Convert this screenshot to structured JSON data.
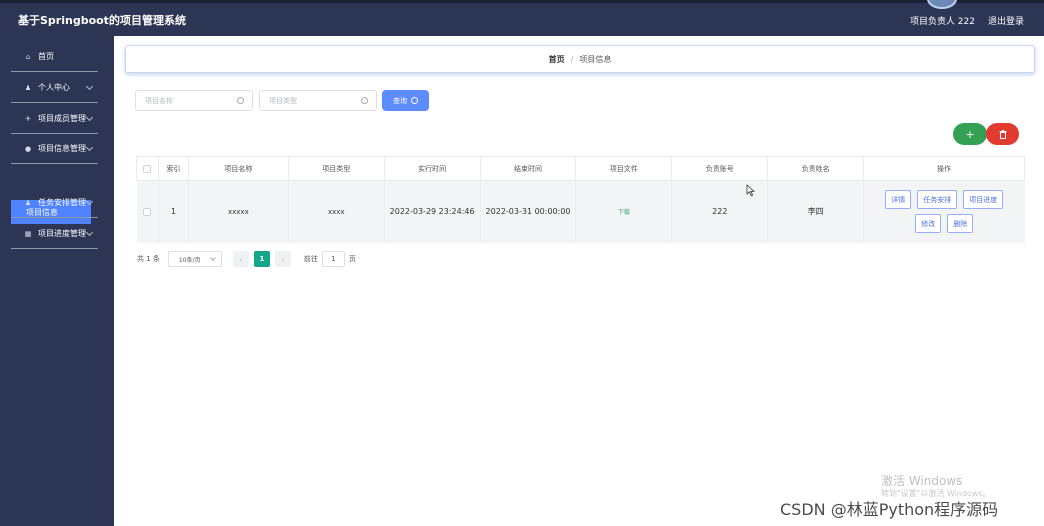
{
  "header": {
    "app_title": "基于Springboot的项目管理系统",
    "user_label": "项目负责人 222",
    "logout_label": "退出登录"
  },
  "sidebar": {
    "items": [
      {
        "label": "首页",
        "icon": "home-icon"
      },
      {
        "label": "个人中心",
        "icon": "user-icon"
      },
      {
        "label": "项目成员管理",
        "icon": "pin-icon"
      },
      {
        "label": "项目信息管理",
        "icon": "location-icon"
      },
      {
        "label": "任务安排管理",
        "icon": "user-icon"
      },
      {
        "label": "项目进度管理",
        "icon": "grid-icon"
      }
    ],
    "active_sub": "项目信息"
  },
  "breadcrumb": {
    "home": "首页",
    "separator": "/",
    "current": "项目信息"
  },
  "search": {
    "name_placeholder": "项目名称",
    "type_placeholder": "项目类型",
    "query_label": "查询"
  },
  "actions": {
    "add_label": "+",
    "delete_icon": "trash-icon"
  },
  "table": {
    "columns": [
      "索引",
      "项目名称",
      "项目类型",
      "实行时间",
      "结束时间",
      "项目文件",
      "负责账号",
      "负责姓名",
      "操作"
    ],
    "rows": [
      {
        "index": "1",
        "name": "xxxxx",
        "type": "xxxx",
        "start": "2022-03-29 23:24:46",
        "end": "2022-03-31 00:00:00",
        "file": "下载",
        "account": "222",
        "owner": "李四",
        "ops": [
          "详情",
          "任务安排",
          "项目进度",
          "修改",
          "删除"
        ]
      }
    ]
  },
  "pagination": {
    "total": "共 1 条",
    "page_size": "10条/页",
    "current_page": "1",
    "goto_label": "前往",
    "goto_value": "1",
    "page_unit": "页"
  },
  "watermarks": {
    "windows_title": "激活 Windows",
    "windows_sub": "转到\"设置\"以激活 Windows。",
    "csdn": "CSDN @林蓝Python程序源码"
  },
  "colors": {
    "nav_bg": "#2d3555",
    "accent": "#5d8cff",
    "active_item": "#4f83ff",
    "add_green": "#33a054",
    "delete_red": "#e33b2f",
    "page_active": "#13a688"
  }
}
